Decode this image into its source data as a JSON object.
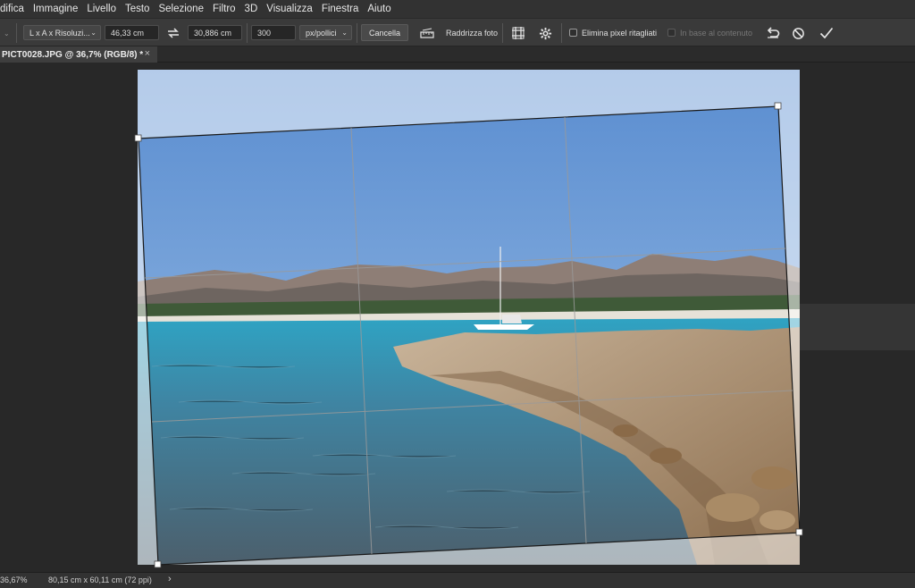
{
  "menu": [
    "difica",
    "Immagine",
    "Livello",
    "Testo",
    "Selezione",
    "Filtro",
    "3D",
    "Visualizza",
    "Finestra",
    "Aiuto"
  ],
  "options": {
    "ratio_dropdown": "L x A x Risoluzi...",
    "width_value": "46,33 cm",
    "height_value": "30,886 cm",
    "resolution_value": "300",
    "units_dropdown": "px/pollici",
    "clear_button": "Cancella",
    "straighten_label": "Raddrizza foto",
    "delete_cropped_label": "Elimina pixel ritagliati",
    "content_aware_label": "In base al contenuto"
  },
  "tab": {
    "title": "PICT0028.JPG @ 36,7% (RGB/8) *",
    "close": "×"
  },
  "icons": {
    "swap": "swap-arrows-icon",
    "straighten": "straighten-ruler-icon",
    "grid": "grid-overlay-icon",
    "settings": "gear-icon",
    "reset": "reset-undo-icon",
    "cancel": "cancel-circle-icon",
    "commit": "checkmark-icon"
  },
  "status": {
    "zoom": "36,67%",
    "doc_size": "80,15 cm x 60,11 cm (72 ppi)",
    "more": "›"
  },
  "colors": {
    "sky": "#6f9ed6",
    "sea": "#3f8fb0",
    "rock": "#b59b7d",
    "ui_dark": "#282828"
  }
}
